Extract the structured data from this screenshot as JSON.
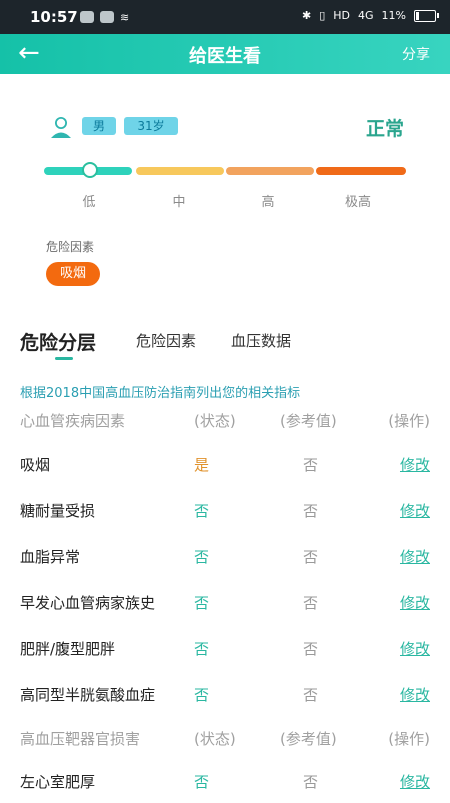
{
  "statusbar": {
    "time": "10:57",
    "network": "HD",
    "signal": "4G",
    "battery": "11%"
  },
  "header": {
    "title": "给医生看",
    "share": "分享"
  },
  "profile": {
    "gender": "男",
    "age": "31岁",
    "status": "正常"
  },
  "scale": {
    "labels": [
      "低",
      "中",
      "高",
      "极高"
    ],
    "colors": [
      "#2ed2bb",
      "#f7c85c",
      "#f2a35e",
      "#f06a18"
    ],
    "level": "低"
  },
  "risk_factors": {
    "title": "危险因素",
    "chips": [
      "吸烟"
    ]
  },
  "tabs": [
    "危险分层",
    "危险因素",
    "血压数据"
  ],
  "note": "根据2018中国高血压防治指南列出您的相关指标",
  "section1": {
    "header": {
      "name": "心血管疾病因素",
      "state": "(状态)",
      "ref": "(参考值)",
      "op": "(操作)"
    },
    "rows": [
      {
        "name": "吸烟",
        "state": "是",
        "ref": "否",
        "op": "修改"
      },
      {
        "name": "糖耐量受损",
        "state": "否",
        "ref": "否",
        "op": "修改"
      },
      {
        "name": "血脂异常",
        "state": "否",
        "ref": "否",
        "op": "修改"
      },
      {
        "name": "早发心血管病家族史",
        "state": "否",
        "ref": "否",
        "op": "修改"
      },
      {
        "name": "肥胖/腹型肥胖",
        "state": "否",
        "ref": "否",
        "op": "修改"
      },
      {
        "name": "高同型半胱氨酸血症",
        "state": "否",
        "ref": "否",
        "op": "修改"
      }
    ]
  },
  "section2": {
    "header": {
      "name": "高血压靶器官损害",
      "state": "(状态)",
      "ref": "(参考值)",
      "op": "(操作)"
    },
    "rows": [
      {
        "name": "左心室肥厚",
        "state": "否",
        "ref": "否",
        "op": "修改"
      }
    ]
  }
}
